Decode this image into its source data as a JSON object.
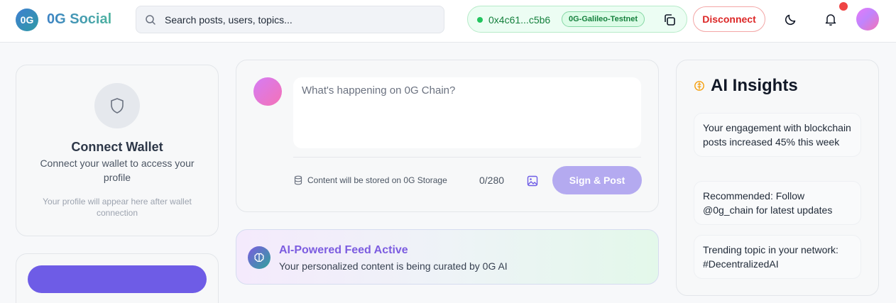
{
  "header": {
    "logo_badge": "0G",
    "app_name": "0G Social",
    "search_placeholder": "Search posts, users, topics...",
    "wallet_address": "0x4c61...c5b6",
    "network": "0G-Galileo-Testnet",
    "disconnect_label": "Disconnect",
    "icons": [
      "search-icon",
      "copy-icon",
      "moon-icon",
      "bell-icon"
    ]
  },
  "sidebar": {
    "wallet_card": {
      "title": "Connect Wallet",
      "description": "Connect your wallet to access your profile",
      "note": "Your profile will appear here after wallet connection",
      "icon": "shield-icon"
    }
  },
  "composer": {
    "placeholder": "What's happening on 0G Chain?",
    "storage_note": "Content will be stored on 0G Storage",
    "char_count": "0/280",
    "submit_label": "Sign & Post"
  },
  "ai_banner": {
    "title": "AI-Powered Feed Active",
    "subtitle": "Your personalized content is being curated by 0G AI",
    "icon": "brain-icon"
  },
  "insights": {
    "title": "AI Insights",
    "items": [
      "Your engagement with blockchain posts increased 45% this week",
      "Recommended: Follow @0g_chain for latest updates",
      "Trending topic in your network: #DecentralizedAI"
    ]
  },
  "colors": {
    "accent": "#6e5ce6",
    "success": "#22c55e",
    "danger": "#dc2626"
  }
}
